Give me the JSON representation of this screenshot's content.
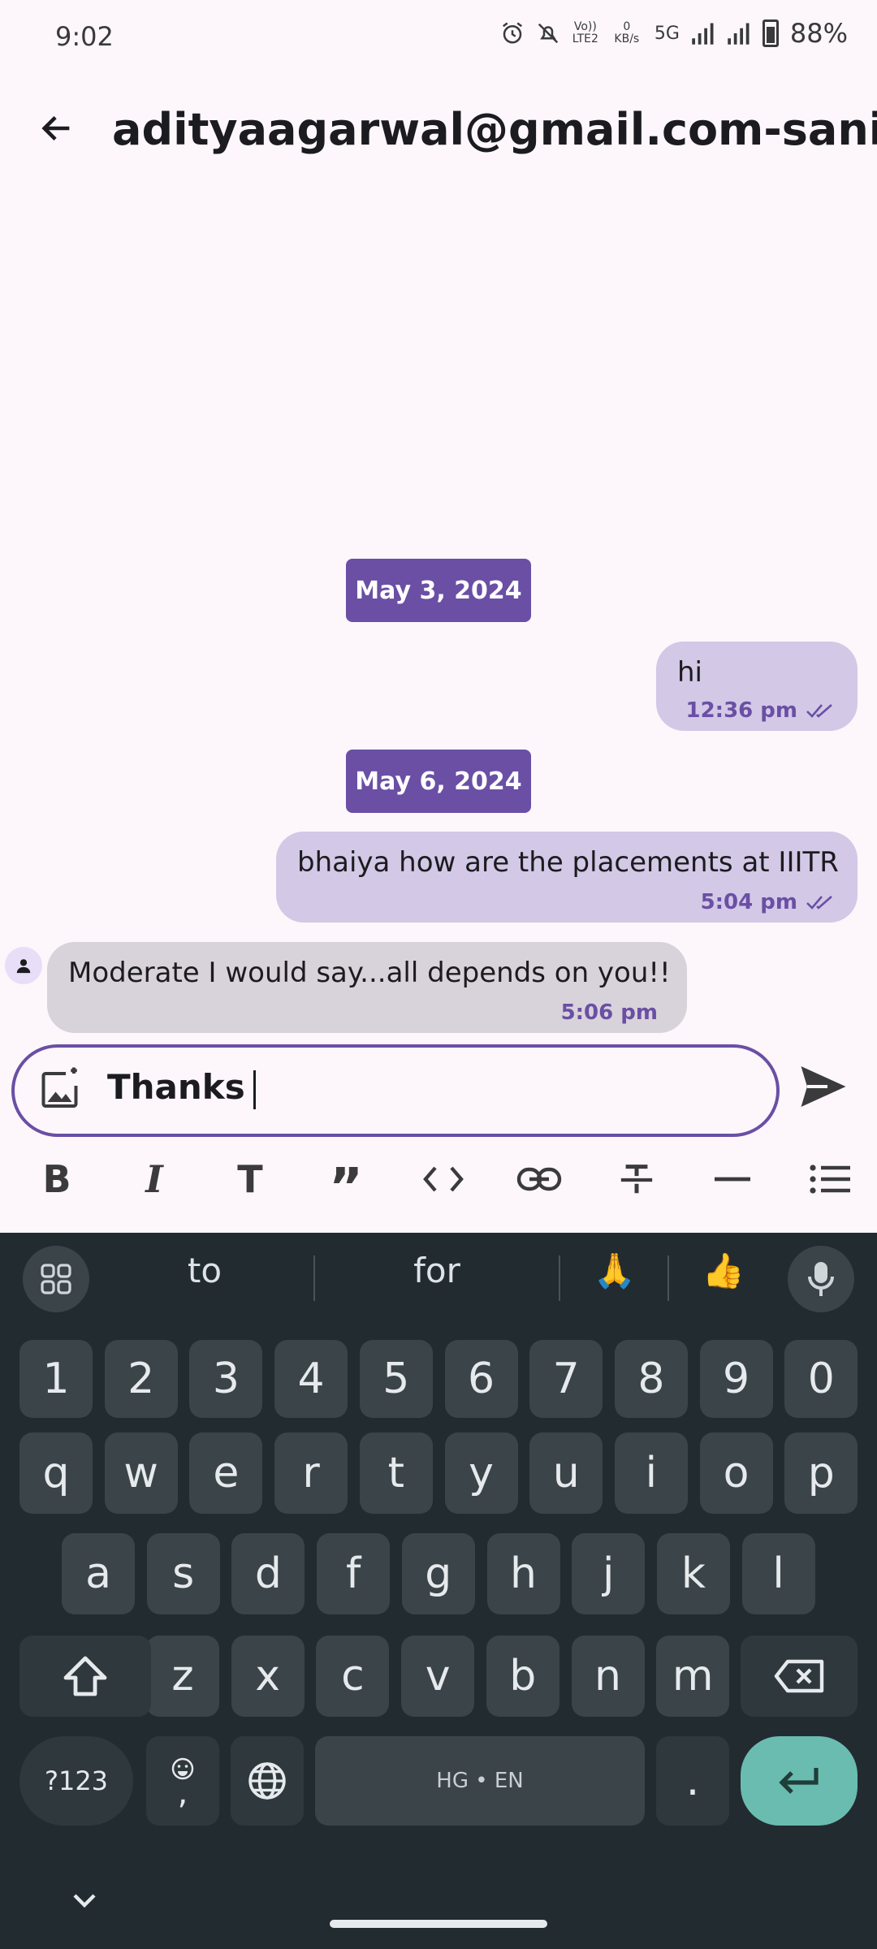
{
  "status_bar": {
    "time": "9:02",
    "vol_lte": "Vo)) LTE2",
    "net_speed": "0 KB/s",
    "net_type": "5G",
    "battery": "88%"
  },
  "header": {
    "title": "adityaagarwal@gmail.com-sani@gmail.com"
  },
  "messages": {
    "date1": "May 3, 2024",
    "msg1": {
      "text": "hi",
      "time": "12:36 pm"
    },
    "date2": "May 6, 2024",
    "msg2": {
      "text": "bhaiya how are the placements at IIITR",
      "time": "5:04 pm"
    },
    "msg3": {
      "text": "Moderate I would say...all depends on you!!",
      "time": "5:06 pm"
    }
  },
  "composer": {
    "value": "Thanks"
  },
  "format_bar": {
    "icons": [
      "bold-icon",
      "italic-icon",
      "heading-icon",
      "quote-icon",
      "code-icon",
      "link-icon",
      "strikethrough-icon",
      "horizontal-rule-icon",
      "list-icon"
    ]
  },
  "keyboard": {
    "suggestions": [
      "to",
      "for",
      "🙏",
      "👍"
    ],
    "numbers": [
      "1",
      "2",
      "3",
      "4",
      "5",
      "6",
      "7",
      "8",
      "9",
      "0"
    ],
    "row1": [
      "q",
      "w",
      "e",
      "r",
      "t",
      "y",
      "u",
      "i",
      "o",
      "p"
    ],
    "row2": [
      "a",
      "s",
      "d",
      "f",
      "g",
      "h",
      "j",
      "k",
      "l"
    ],
    "row3": [
      "z",
      "x",
      "c",
      "v",
      "b",
      "n",
      "m"
    ],
    "symbols_label": "?123",
    "comma_label": ",",
    "space_label": "HG • EN",
    "period_label": "."
  },
  "colors": {
    "accent": "#6a4fa5",
    "outgoing_bubble": "#d3c8e6",
    "incoming_bubble": "#d8d3da",
    "keyboard_bg": "#222b30",
    "enter_key": "#6bbcb0"
  }
}
